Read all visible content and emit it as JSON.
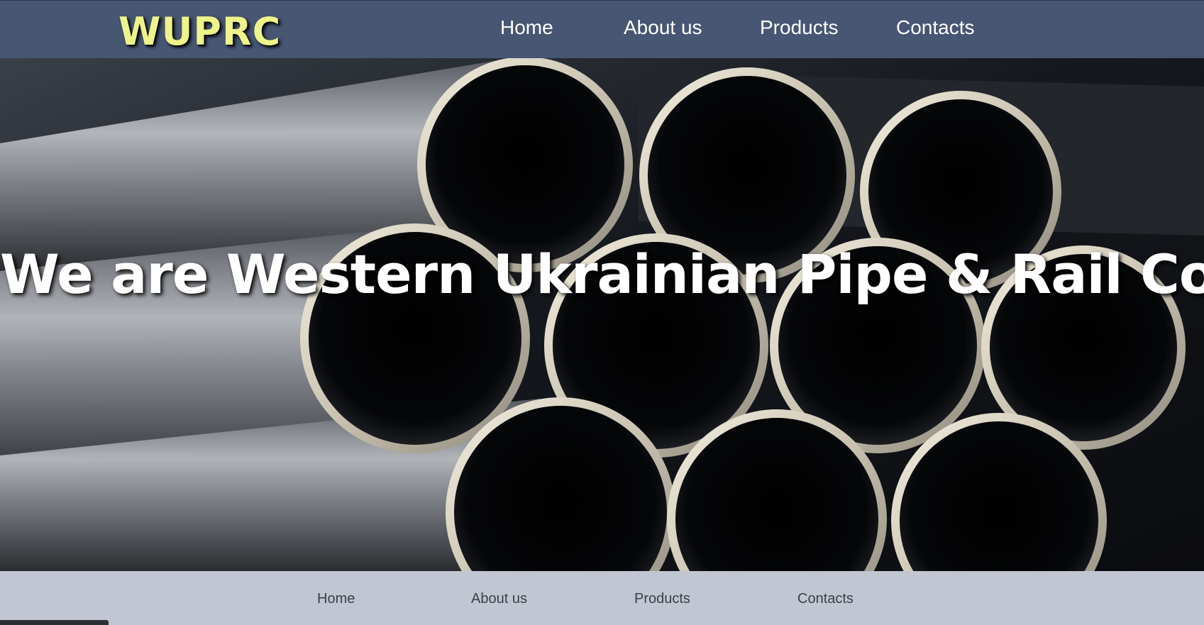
{
  "header": {
    "logo": "WUPRC",
    "nav": [
      "Home",
      "About us",
      "Products",
      "Contacts"
    ]
  },
  "hero": {
    "title": "We are Western Ukrainian Pipe & Rail Company"
  },
  "footer": {
    "nav": [
      "Home",
      "About us",
      "Products",
      "Contacts"
    ]
  },
  "colors": {
    "header_bg": "#475672",
    "logo": "#eef38a",
    "footer_bg": "#c1c6d2"
  }
}
